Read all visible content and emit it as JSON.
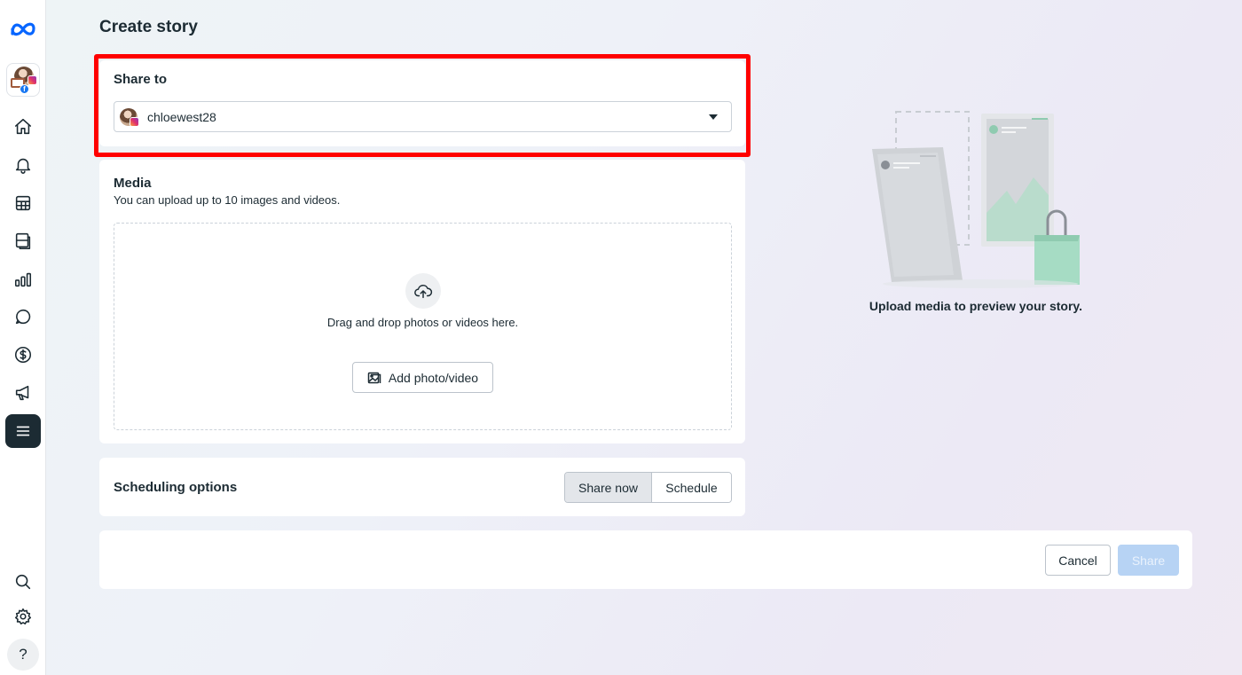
{
  "page": {
    "title": "Create story"
  },
  "sidebar": {
    "items": [
      {
        "name": "home-icon"
      },
      {
        "name": "bell-icon"
      },
      {
        "name": "grid-icon"
      },
      {
        "name": "pages-icon"
      },
      {
        "name": "chart-icon"
      },
      {
        "name": "chat-icon"
      },
      {
        "name": "dollar-icon"
      },
      {
        "name": "megaphone-icon"
      },
      {
        "name": "menu-icon",
        "active": true
      }
    ],
    "bottom": [
      {
        "name": "search-icon"
      },
      {
        "name": "gear-icon"
      },
      {
        "name": "help-icon",
        "label": "?"
      }
    ]
  },
  "share_to": {
    "label": "Share to",
    "selected_account": "chloewest28"
  },
  "media": {
    "label": "Media",
    "subtitle": "You can upload up to 10 images and videos.",
    "drop_text": "Drag and drop photos or videos here.",
    "add_button": "Add photo/video"
  },
  "scheduling": {
    "label": "Scheduling options",
    "options": [
      "Share now",
      "Schedule"
    ],
    "selected": "Share now"
  },
  "footer": {
    "cancel": "Cancel",
    "share": "Share"
  },
  "preview": {
    "text": "Upload media to preview your story."
  },
  "colors": {
    "highlight": "#ff0000",
    "share_disabled": "#b7d3f4",
    "brand": "#0866ff"
  }
}
